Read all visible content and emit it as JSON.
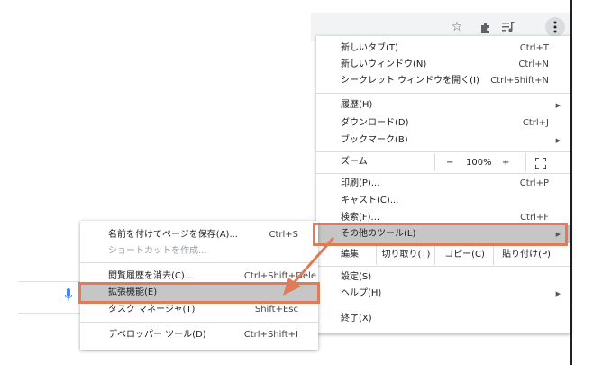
{
  "main_menu": {
    "items_top": [
      {
        "label": "新しいタブ(T)",
        "shortcut": "Ctrl+T"
      },
      {
        "label": "新しいウィンドウ(N)",
        "shortcut": "Ctrl+N"
      },
      {
        "label": "シークレット ウィンドウを開く(I)",
        "shortcut": "Ctrl+Shift+N"
      }
    ],
    "items_mid": [
      {
        "label": "履歴(H)",
        "shortcut": ""
      },
      {
        "label": "ダウンロード(D)",
        "shortcut": "Ctrl+J"
      },
      {
        "label": "ブックマーク(B)",
        "shortcut": ""
      }
    ],
    "zoom": {
      "label": "ズーム",
      "minus": "−",
      "value": "100%",
      "plus": "+"
    },
    "items_tools": [
      {
        "label": "印刷(P)...",
        "shortcut": "Ctrl+P"
      },
      {
        "label": "キャスト(C)...",
        "shortcut": ""
      },
      {
        "label": "検索(F)...",
        "shortcut": "Ctrl+F"
      },
      {
        "label": "その他のツール(L)",
        "shortcut": ""
      }
    ],
    "edit": {
      "label": "編集",
      "cut": "切り取り(T)",
      "copy": "コピー(C)",
      "paste": "貼り付け(P)"
    },
    "items_bottom": [
      {
        "label": "設定(S)",
        "shortcut": ""
      },
      {
        "label": "ヘルプ(H)",
        "shortcut": ""
      }
    ],
    "exit": {
      "label": "終了(X)"
    }
  },
  "submenu": {
    "items": [
      {
        "label": "名前を付けてページを保存(A)...",
        "shortcut": "Ctrl+S"
      },
      {
        "label": "ショートカットを作成...",
        "shortcut": ""
      },
      {
        "label": "閲覧履歴を消去(C)...",
        "shortcut": "Ctrl+Shift+Dele"
      },
      {
        "label": "拡張機能(E)",
        "shortcut": ""
      },
      {
        "label": "タスク マネージャ(T)",
        "shortcut": "Shift+Esc"
      },
      {
        "label": "デベロッパー ツール(D)",
        "shortcut": "Ctrl+Shift+I"
      }
    ]
  },
  "icons": {
    "star": "star-icon",
    "extensions": "puzzle-icon",
    "media": "playlist-icon",
    "menu": "kebab-menu-icon",
    "fullscreen": "fullscreen-icon",
    "mic": "microphone-icon"
  },
  "colors": {
    "highlight": "#c6c6c6",
    "annotation": "#e07b5a",
    "mic": "#4285f4"
  }
}
